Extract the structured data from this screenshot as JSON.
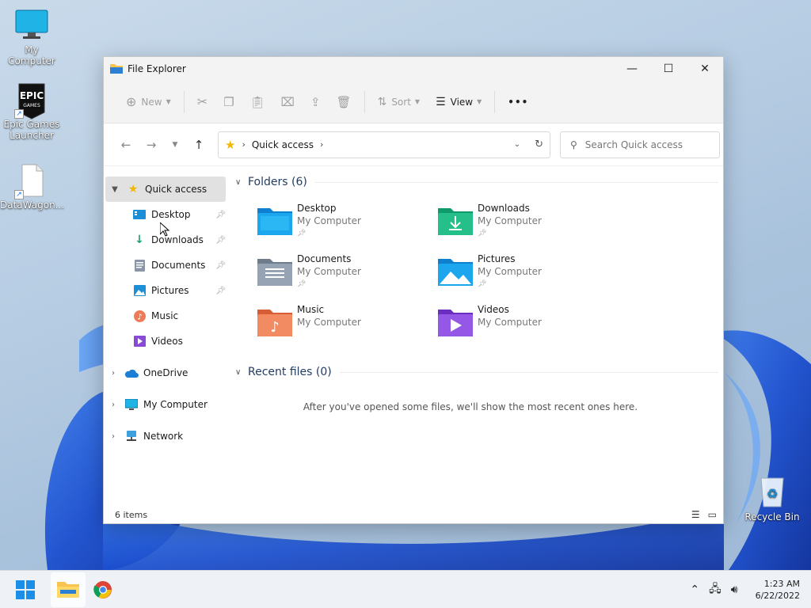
{
  "desktop": {
    "icons": [
      {
        "label": "My Computer"
      },
      {
        "label": "Epic Games Launcher",
        "logo_text": "EPIC GAMES"
      },
      {
        "label": "DataWagon..."
      },
      {
        "label": "Recycle Bin"
      }
    ]
  },
  "window": {
    "title": "File Explorer",
    "controls": {
      "minimize": "—",
      "maximize": "☐",
      "close": "✕"
    },
    "toolbar": {
      "new_label": "New",
      "sort_label": "Sort",
      "view_label": "View",
      "more_label": "•••"
    },
    "address": {
      "crumb": "Quick access",
      "search_placeholder": "Search Quick access"
    },
    "sidebar": {
      "quick_access": "Quick access",
      "pinned": [
        {
          "label": "Desktop",
          "pinned": true
        },
        {
          "label": "Downloads",
          "pinned": true
        },
        {
          "label": "Documents",
          "pinned": true
        },
        {
          "label": "Pictures",
          "pinned": true
        },
        {
          "label": "Music",
          "pinned": false
        },
        {
          "label": "Videos",
          "pinned": false
        }
      ],
      "roots": [
        {
          "label": "OneDrive"
        },
        {
          "label": "My Computer"
        },
        {
          "label": "Network"
        }
      ]
    },
    "content": {
      "folders_header": "Folders (6)",
      "folders": [
        {
          "name": "Desktop",
          "location": "My Computer",
          "pinned": true
        },
        {
          "name": "Downloads",
          "location": "My Computer",
          "pinned": true
        },
        {
          "name": "Documents",
          "location": "My Computer",
          "pinned": true
        },
        {
          "name": "Pictures",
          "location": "My Computer",
          "pinned": true
        },
        {
          "name": "Music",
          "location": "My Computer",
          "pinned": false
        },
        {
          "name": "Videos",
          "location": "My Computer",
          "pinned": false
        }
      ],
      "recent_header": "Recent files (0)",
      "recent_empty": "After you've opened some files, we'll show the most recent ones here."
    },
    "status": {
      "items": "6 items"
    }
  },
  "taskbar": {
    "time": "1:23 AM",
    "date": "6/22/2022"
  },
  "colors": {
    "accent": "#0067c0",
    "folder_yellow": "#f8c44f",
    "bloom_blue": "#1b4fc4"
  }
}
